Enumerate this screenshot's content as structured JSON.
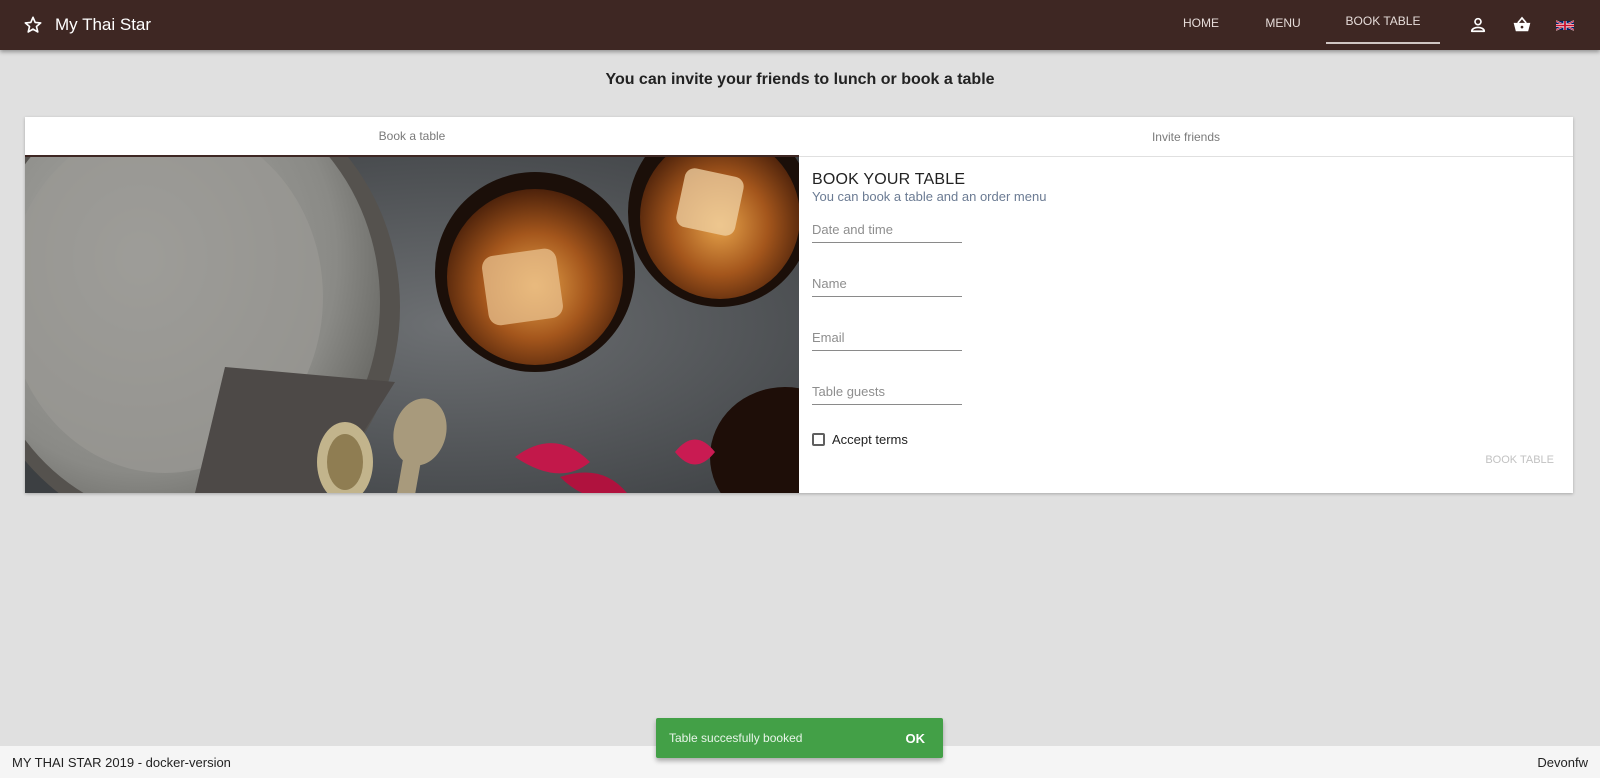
{
  "header": {
    "brand_icon": "star-outline-icon",
    "title": "My Thai Star",
    "nav": [
      {
        "label": "HOME"
      },
      {
        "label": "MENU"
      },
      {
        "label": "BOOK TABLE",
        "active": true
      }
    ],
    "icons": [
      "account-icon",
      "shopping-basket-icon",
      "uk-flag-icon"
    ],
    "bg_color": "#3e2723"
  },
  "page": {
    "title": "You can invite your friends to lunch or book a table"
  },
  "tabs": [
    {
      "label": "Book a table",
      "active": true
    },
    {
      "label": "Invite friends",
      "active": false
    }
  ],
  "form": {
    "title": "BOOK YOUR TABLE",
    "subtitle": "You can book a table and an order menu",
    "fields": {
      "date": {
        "placeholder": "Date and time",
        "value": ""
      },
      "name": {
        "placeholder": "Name",
        "value": ""
      },
      "email": {
        "placeholder": "Email",
        "value": ""
      },
      "guests": {
        "placeholder": "Table guests",
        "value": ""
      }
    },
    "accept_terms": {
      "label": "Accept terms",
      "checked": false
    },
    "submit_label": "BOOK TABLE"
  },
  "snackbar": {
    "message": "Table succesfully booked",
    "action": "OK",
    "color": "#43a047"
  },
  "footer": {
    "left": "MY THAI STAR 2019 - docker-version",
    "right": "Devonfw"
  }
}
